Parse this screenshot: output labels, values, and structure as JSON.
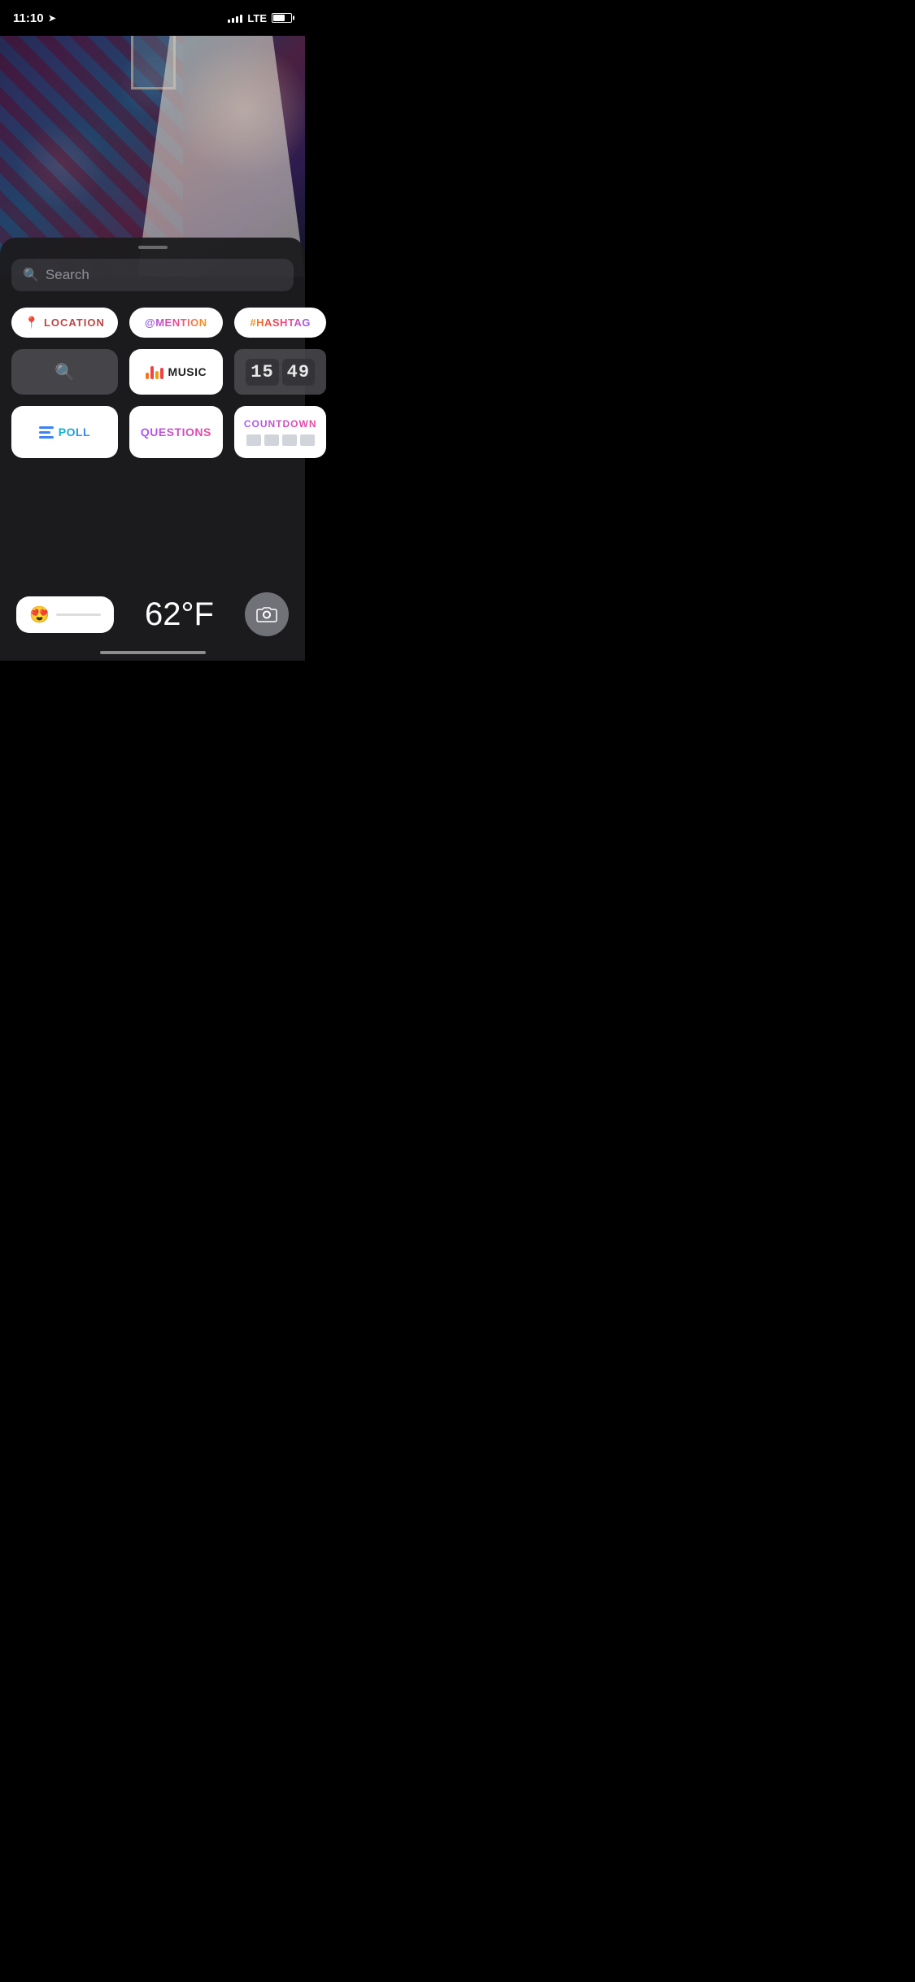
{
  "statusBar": {
    "time": "11:10",
    "networkType": "LTE",
    "batteryPercent": 65
  },
  "search": {
    "placeholder": "Search"
  },
  "stickers": {
    "row1": [
      {
        "id": "location",
        "label": "LOCATION"
      },
      {
        "id": "mention",
        "label": "@MENTION"
      },
      {
        "id": "hashtag",
        "label": "#HASHTAG"
      }
    ],
    "row2": [
      {
        "id": "search-plain",
        "label": ""
      },
      {
        "id": "music",
        "label": "MUSIC"
      },
      {
        "id": "time",
        "label": "15 49"
      }
    ],
    "row3": [
      {
        "id": "poll",
        "label": "POLL"
      },
      {
        "id": "questions",
        "label": "QUESTIONS"
      },
      {
        "id": "countdown",
        "label": "COUNTDOWN"
      }
    ]
  },
  "bottomBar": {
    "emoji": "😍",
    "temperature": "62°F",
    "cameraLabel": "camera"
  }
}
